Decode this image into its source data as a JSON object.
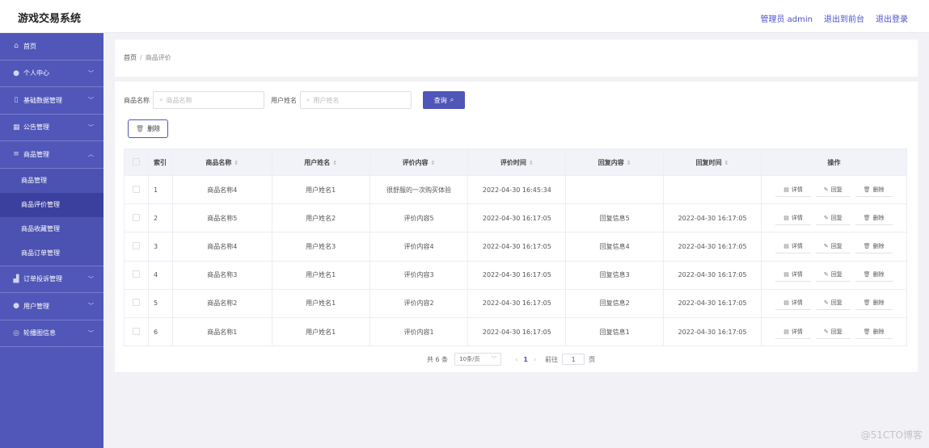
{
  "header": {
    "logo": "游戏交易系统",
    "admin": "管理员 admin",
    "to_front": "退出到前台",
    "logout": "退出登录"
  },
  "sidebar": {
    "items": [
      {
        "label": "首页",
        "icon": "home-icon"
      },
      {
        "label": "个人中心",
        "icon": "user-icon"
      },
      {
        "label": "基础数据管理",
        "icon": "data-icon"
      },
      {
        "label": "公告管理",
        "icon": "grid-icon"
      },
      {
        "label": "商品管理",
        "icon": "list-icon"
      }
    ],
    "sub_items": [
      "商品管理",
      "商品评价管理",
      "商品收藏管理",
      "商品订单管理"
    ],
    "items_after": [
      {
        "label": "订单投诉管理",
        "icon": "chart-icon"
      },
      {
        "label": "用户管理",
        "icon": "user-icon"
      },
      {
        "label": "轮播图信息",
        "icon": "globe-icon"
      }
    ]
  },
  "breadcrumb": {
    "home": "首页",
    "sep": "/",
    "current": "商品评价"
  },
  "search": {
    "product_label": "商品名称",
    "product_placeholder": "商品名称",
    "user_label": "用户姓名",
    "user_placeholder": "用户姓名",
    "query_button": "查询"
  },
  "toolbar": {
    "delete_button": "删除"
  },
  "table": {
    "headers": [
      "索引",
      "商品名称",
      "用户姓名",
      "评价内容",
      "评价时间",
      "回复内容",
      "回复时间",
      "操作"
    ],
    "rows": [
      {
        "idx": "1",
        "product": "商品名称4",
        "user": "用户姓名1",
        "content": "很舒服的一次购买体验",
        "time": "2022-04-30 16:45:34",
        "reply": "",
        "reply_time": ""
      },
      {
        "idx": "2",
        "product": "商品名称5",
        "user": "用户姓名2",
        "content": "评价内容5",
        "time": "2022-04-30 16:17:05",
        "reply": "回复信息5",
        "reply_time": "2022-04-30 16:17:05"
      },
      {
        "idx": "3",
        "product": "商品名称4",
        "user": "用户姓名3",
        "content": "评价内容4",
        "time": "2022-04-30 16:17:05",
        "reply": "回复信息4",
        "reply_time": "2022-04-30 16:17:05"
      },
      {
        "idx": "4",
        "product": "商品名称3",
        "user": "用户姓名1",
        "content": "评价内容3",
        "time": "2022-04-30 16:17:05",
        "reply": "回复信息3",
        "reply_time": "2022-04-30 16:17:05"
      },
      {
        "idx": "5",
        "product": "商品名称2",
        "user": "用户姓名1",
        "content": "评价内容2",
        "time": "2022-04-30 16:17:05",
        "reply": "回复信息2",
        "reply_time": "2022-04-30 16:17:05"
      },
      {
        "idx": "6",
        "product": "商品名称1",
        "user": "用户姓名1",
        "content": "评价内容1",
        "time": "2022-04-30 16:17:05",
        "reply": "回复信息1",
        "reply_time": "2022-04-30 16:17:05"
      }
    ],
    "op_detail": "详情",
    "op_reply": "回复",
    "op_delete": "删除"
  },
  "pagination": {
    "total": "共 6 条",
    "page_size": "10条/页",
    "current_page": "1",
    "goto_label": "前往",
    "goto_value": "1",
    "page_suffix": "页"
  },
  "watermark": "@51CTO博客",
  "colors": {
    "accent": "#4f56b8",
    "sidebar": "#5157b8",
    "sidebar_active": "#3b3f9e"
  }
}
